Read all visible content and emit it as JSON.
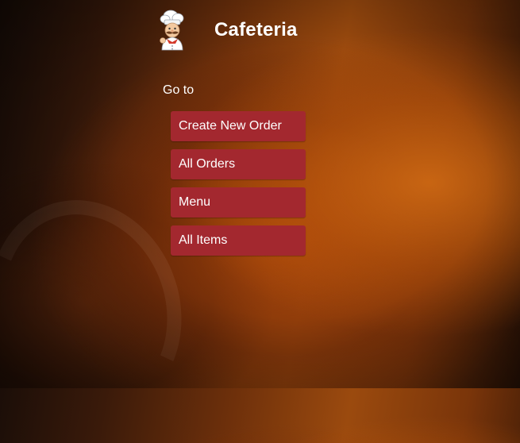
{
  "app": {
    "title": "Cafeteria",
    "logo_icon": "chef-icon"
  },
  "nav": {
    "heading": "Go to",
    "items": [
      {
        "label": "Create New Order"
      },
      {
        "label": "All Orders"
      },
      {
        "label": "Menu"
      },
      {
        "label": "All Items"
      }
    ]
  },
  "colors": {
    "button_bg": "#a3282f",
    "text": "#ffffff",
    "background_accent": "#c9650f"
  }
}
